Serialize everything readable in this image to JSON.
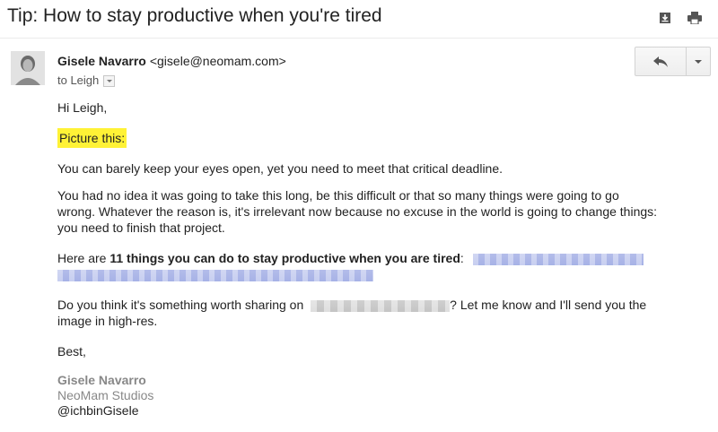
{
  "email": {
    "subject": "Tip: How to stay productive when you're tired",
    "sender_name": "Gisele Navarro",
    "sender_email": "<gisele@neomam.com>",
    "to": "to Leigh"
  },
  "icons": {
    "download": "download-icon",
    "print": "print-icon",
    "reply": "reply-icon",
    "more": "chevron-down-icon"
  },
  "body": {
    "greeting": "Hi Leigh,",
    "highlight": "Picture this:",
    "p1": "You can barely keep your eyes open, yet you need to meet that critical deadline.",
    "p2_line1": "You had no idea it was going to take this long, be this difficult or that so many things were going to go",
    "p2_line2": "wrong. Whatever the reason is, it's irrelevant now because no excuse in the world is going to change things:",
    "p2_line3": "you need to finish that project.",
    "p3_prefix": "Here are ",
    "p3_bold": "11 things you can do to stay productive when you are tired",
    "p3_suffix": ":",
    "p4_prefix": "Do you think it's something worth sharing on",
    "p4_suffix": "? Let me know and I'll send you the",
    "p4_line2": "image in high-res.",
    "closing": "Best,"
  },
  "signature": {
    "name": "Gisele Navarro",
    "company": "NeoMam Studios",
    "handle": "@ichbinGisele"
  },
  "colors": {
    "highlight": "#fff236",
    "redacted_link": "#b0bbea",
    "redacted_text": "#cccccc"
  }
}
